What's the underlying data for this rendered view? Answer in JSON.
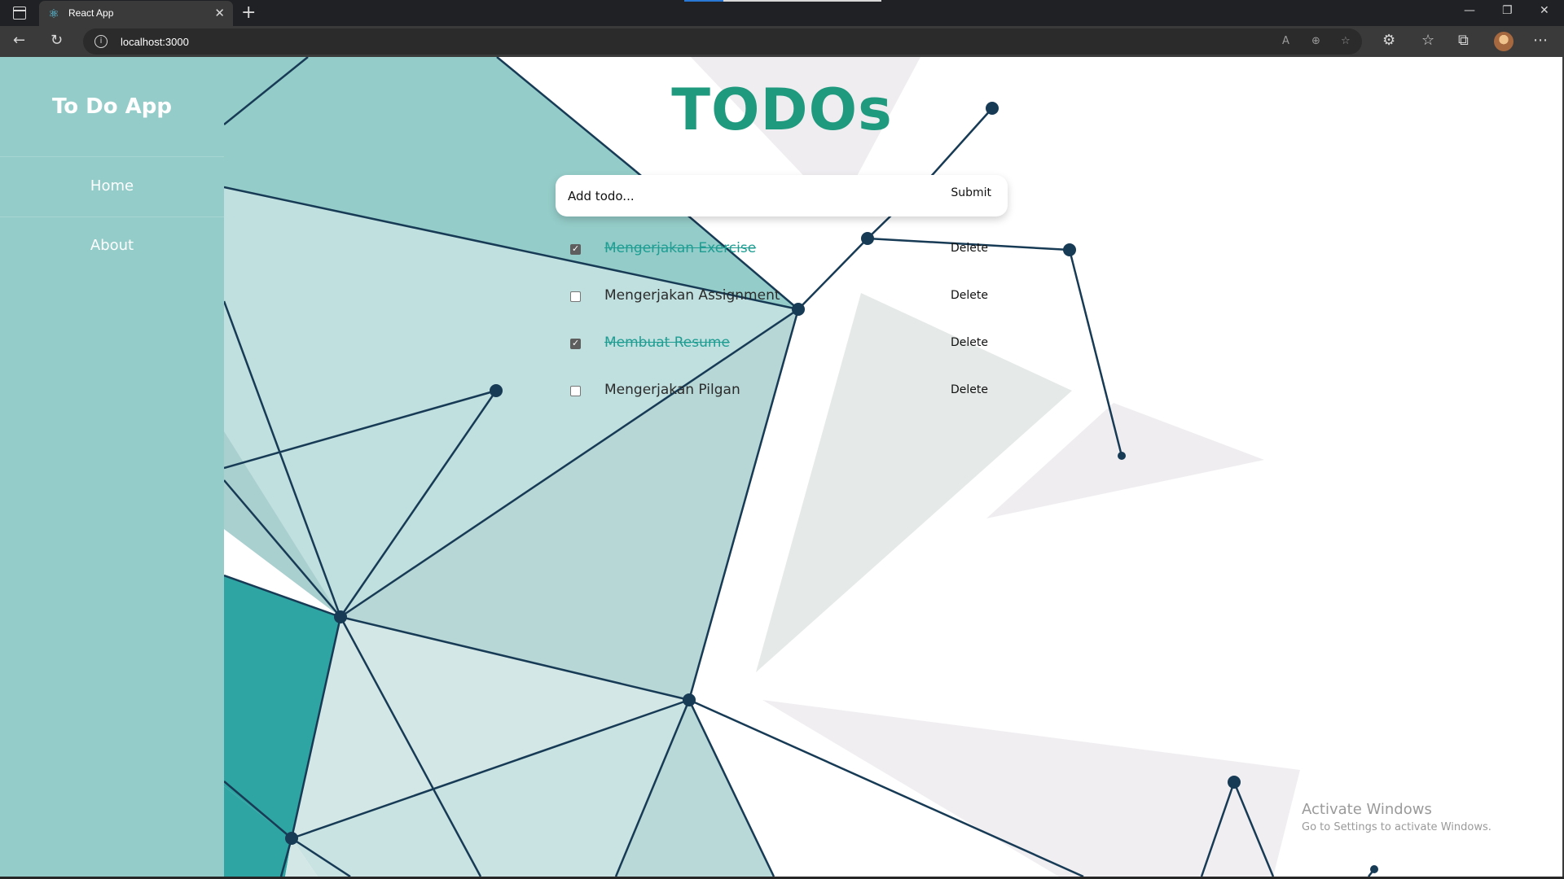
{
  "browser": {
    "tab_title": "React App",
    "tab_favicon": "react-logo-icon",
    "new_tab": "+",
    "url": "localhost:3000",
    "controls": {
      "minimize": "—",
      "restore": "❐",
      "close": "✕"
    },
    "icons": [
      "back-icon",
      "refresh-icon",
      "read-aloud-icon",
      "zoom-icon",
      "add-favorite-icon",
      "extensions-icon",
      "favorites-icon",
      "collections-icon",
      "profile-avatar",
      "more-menu-icon"
    ]
  },
  "sidebar": {
    "title": "To Do App",
    "items": [
      {
        "label": "Home"
      },
      {
        "label": "About"
      }
    ]
  },
  "main": {
    "heading": "TODOs",
    "form": {
      "placeholder": "Add todo...",
      "submit_label": "Submit"
    },
    "todos": [
      {
        "text": "Mengerjakan Exercise",
        "completed": true,
        "delete_label": "Delete"
      },
      {
        "text": "Mengerjakan Assignment",
        "completed": false,
        "delete_label": "Delete"
      },
      {
        "text": "Membuat Resume",
        "completed": true,
        "delete_label": "Delete"
      },
      {
        "text": "Mengerjakan Pilgan",
        "completed": false,
        "delete_label": "Delete"
      }
    ]
  },
  "watermark": {
    "line1": "Activate Windows",
    "line2": "Go to Settings to activate Windows."
  },
  "colors": {
    "sidebar": "#94ccc9",
    "heading": "#1f9a7e",
    "completed_text": "#1e9e93",
    "network_lines": "#173a55"
  }
}
